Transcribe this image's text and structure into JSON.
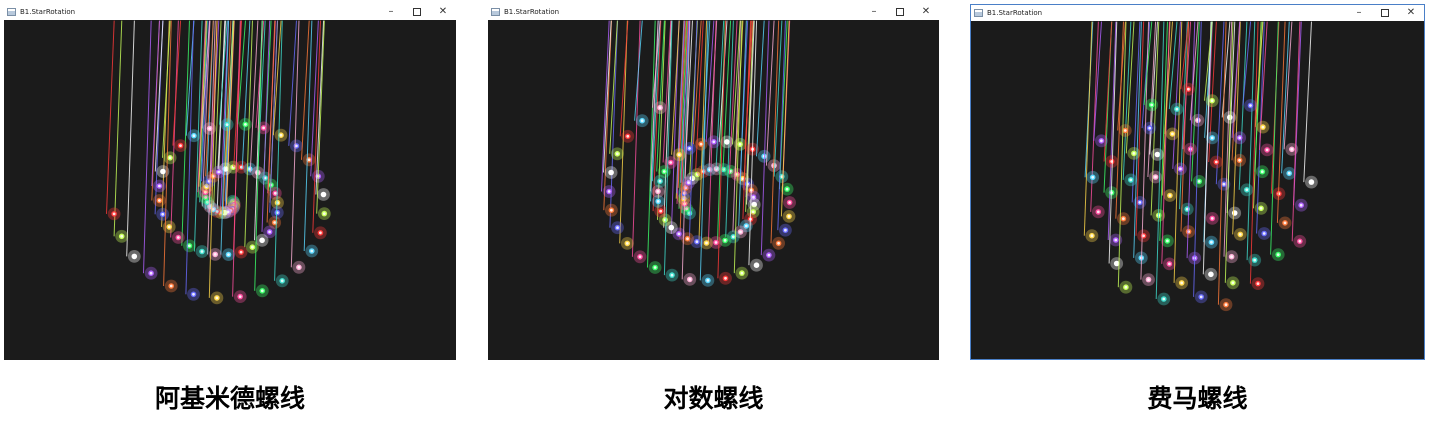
{
  "windows": [
    {
      "title": "B1.StarRotation",
      "caption": "阿基米德螺线"
    },
    {
      "title": "B1.StarRotation",
      "caption": "对数螺线"
    },
    {
      "title": "B1.StarRotation",
      "caption": "费马螺线"
    }
  ],
  "window_controls": {
    "minimize": "–",
    "close": "✕"
  },
  "star_colors": [
    "#40e0d0",
    "#3cff6a",
    "#ff4fa0",
    "#ffd84a",
    "#6a6cff",
    "#ff7a3a",
    "#b060ff",
    "#ffffff",
    "#c8ff5a",
    "#ff3a3a",
    "#5ad8ff",
    "#ffb0d8"
  ]
}
